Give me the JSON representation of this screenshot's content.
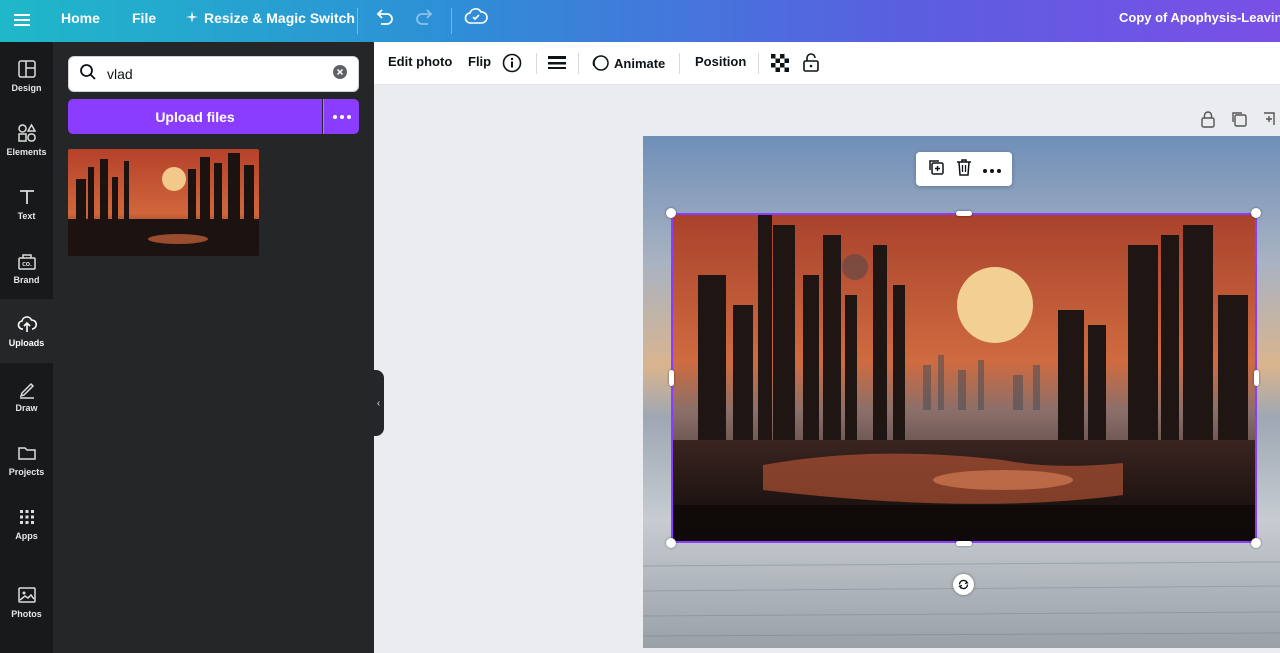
{
  "topbar": {
    "home_label": "Home",
    "file_label": "File",
    "resize_label": "Resize & Magic Switch",
    "doc_title": "Copy of Apophysis-Leaving"
  },
  "rail": {
    "items": [
      {
        "label": "Design",
        "icon": "layout-icon"
      },
      {
        "label": "Elements",
        "icon": "shapes-icon"
      },
      {
        "label": "Text",
        "icon": "text-icon"
      },
      {
        "label": "Brand",
        "icon": "brand-icon"
      },
      {
        "label": "Uploads",
        "icon": "cloud-upload-icon"
      },
      {
        "label": "Draw",
        "icon": "pen-icon"
      },
      {
        "label": "Projects",
        "icon": "folder-icon"
      },
      {
        "label": "Apps",
        "icon": "grid-icon"
      },
      {
        "label": "Photos",
        "icon": "image-icon"
      }
    ],
    "active": "Uploads"
  },
  "panel": {
    "search_value": "vlad",
    "upload_label": "Upload files"
  },
  "toolbar": {
    "edit_photo": "Edit photo",
    "flip": "Flip",
    "animate": "Animate",
    "position": "Position"
  },
  "colors": {
    "accent": "#8b3dff",
    "rail_bg": "#18191b",
    "panel_bg": "#252627"
  }
}
